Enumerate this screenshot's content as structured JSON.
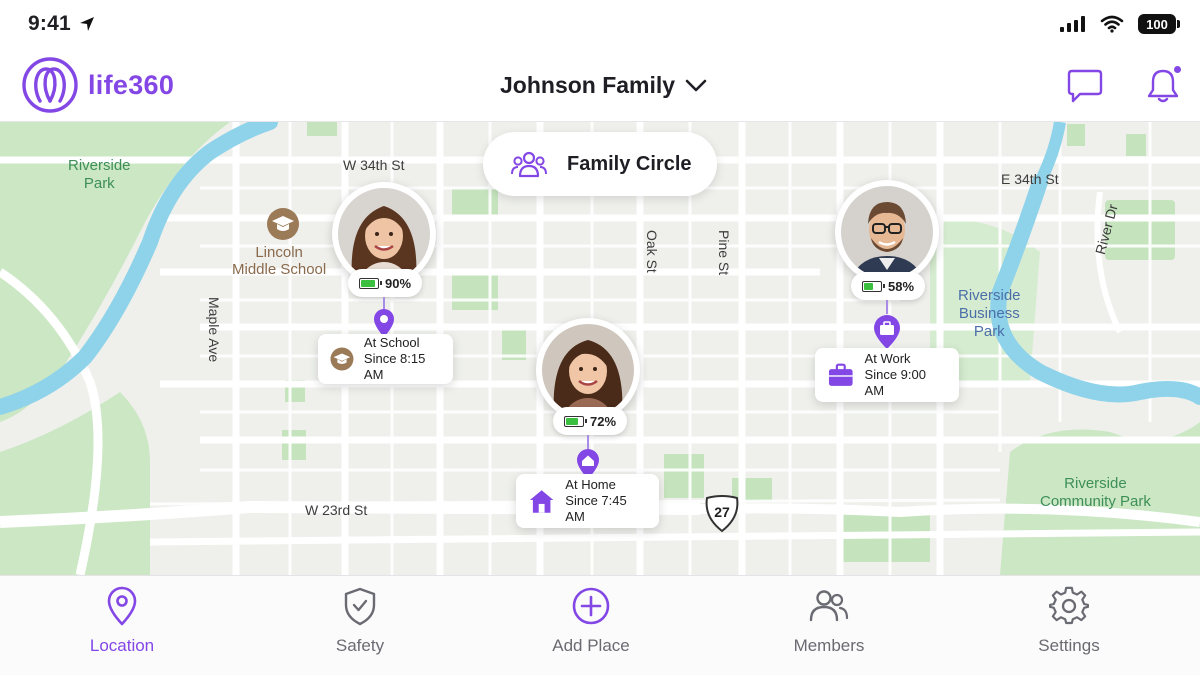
{
  "status_bar": {
    "time": "9:41",
    "battery": "100"
  },
  "header": {
    "app_name": "life360",
    "circle_name": "Johnson Family"
  },
  "map": {
    "family_circle_label": "Family Circle",
    "streets": {
      "w34": "W 34th St",
      "e34": "E 34th St",
      "w23": "W 23rd St",
      "maple": "Maple Ave",
      "oak": "Oak St",
      "pine": "Pine St",
      "river_dr": "River Dr"
    },
    "places": {
      "riverside_park": "Riverside\nPark",
      "lincoln_school": "Lincoln\nMiddle School",
      "riverside_business": "Riverside\nBusiness\nPark",
      "riverside_community": "Riverside\nCommunity Park"
    },
    "route_number": "27",
    "members": [
      {
        "battery": "90%",
        "battery_level": 0.9,
        "status": "At School",
        "since": "Since 8:15 AM"
      },
      {
        "battery": "72%",
        "battery_level": 0.72,
        "status": "At Home",
        "since": "Since 7:45 AM"
      },
      {
        "battery": "58%",
        "battery_level": 0.58,
        "status": "At Work",
        "since": "Since 9:00 AM"
      }
    ]
  },
  "nav": {
    "location": "Location",
    "safety": "Safety",
    "add_place": "Add Place",
    "members": "Members",
    "settings": "Settings"
  },
  "colors": {
    "accent": "#8347e6",
    "park": "#c7e6c1",
    "water": "#8fd3ea",
    "school": "#9b7a58"
  }
}
